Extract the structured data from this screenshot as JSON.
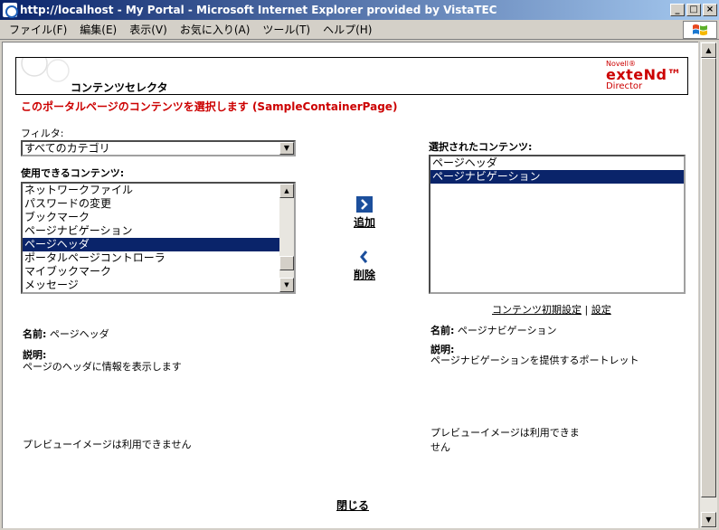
{
  "window": {
    "title": "http://localhost - My Portal - Microsoft Internet Explorer provided by VistaTEC",
    "minimize": "_",
    "maximize": "□",
    "close": "×"
  },
  "menu": {
    "items": [
      "ファイル(F)",
      "編集(E)",
      "表示(V)",
      "お気に入り(A)",
      "ツール(T)",
      "ヘルプ(H)"
    ]
  },
  "header": {
    "title": "コンテンツセレクタ",
    "brand_small": "Novell®",
    "brand_main": "exteNd™",
    "brand_sub": "Director"
  },
  "heading": "このポータルページのコンテンツを選択します (SampleContainerPage)",
  "filter": {
    "label": "フィルタ:",
    "selected": "すべてのカテゴリ"
  },
  "available": {
    "label": "使用できるコンテンツ:",
    "items": [
      "ネットワークファイル",
      "パスワードの変更",
      "ブックマーク",
      "ページナビゲーション",
      "ページヘッダ",
      "ポータルページコントローラ",
      "マイブックマーク",
      "メッセージ"
    ],
    "selected_index": 4
  },
  "actions": {
    "add": "追加",
    "remove": "削除"
  },
  "selected_content": {
    "label": "選択されたコンテンツ:",
    "items": [
      "ページヘッダ",
      "ページナビゲーション"
    ],
    "selected_index": 1
  },
  "links": {
    "init_settings": "コンテンツ初期設定",
    "separator": "|",
    "settings": "設定"
  },
  "left_detail": {
    "name_label": "名前:",
    "name_value": "ページヘッダ",
    "desc_label": "説明:",
    "desc_value": "ページのヘッダに情報を表示します",
    "preview": "プレビューイメージは利用できません"
  },
  "right_detail": {
    "name_label": "名前:",
    "name_value": "ページナビゲーション",
    "desc_label": "説明:",
    "desc_value": "ページナビゲーションを提供するポートレット",
    "preview_line1": "プレビューイメージは利用できま",
    "preview_line2": "せん"
  },
  "footer": {
    "close": "閉じる"
  },
  "colors": {
    "accent_red": "#cc0000",
    "selection": "#0a246a",
    "titlebar": "#0a246a",
    "arrow_blue": "#1c4f9c"
  },
  "icons": [
    "ie-icon",
    "windows-logo-icon",
    "arrow-right-icon",
    "arrow-left-icon"
  ]
}
